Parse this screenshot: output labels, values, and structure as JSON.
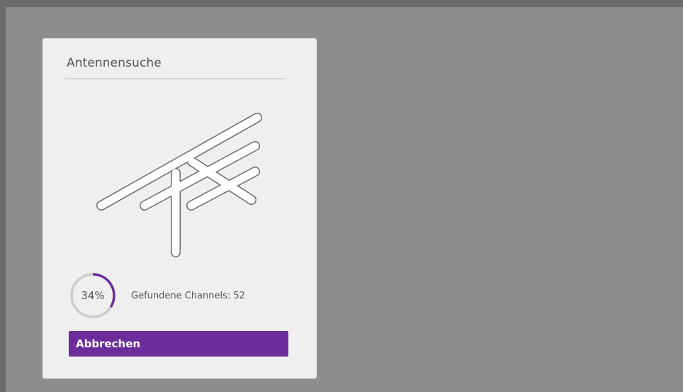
{
  "dialog": {
    "title": "Antennensuche",
    "illustration_icon": "antenna-icon",
    "progress": {
      "percent_label": "34%",
      "fraction": 0.34
    },
    "channels_found_text": "Gefundene Channels: 52",
    "cancel_label": "Abbrechen"
  },
  "colors": {
    "accent": "#6c2c9c",
    "panel_background": "#efefef",
    "screen_background": "#8d8d8d",
    "progress_track": "#cccccc",
    "text": "#555555"
  }
}
